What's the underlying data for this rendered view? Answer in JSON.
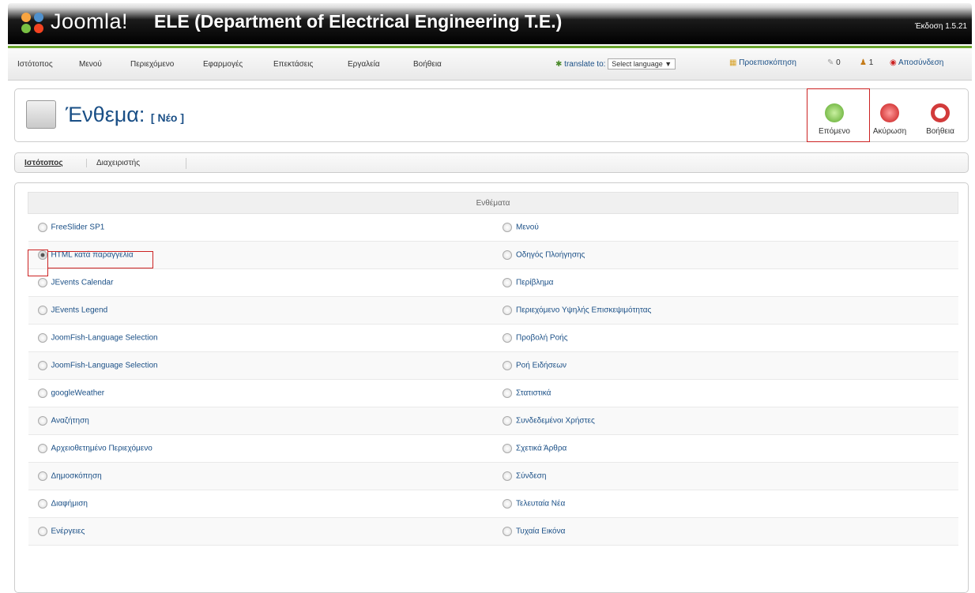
{
  "header": {
    "brand": "Joomla!",
    "site_name": "ELE (Department of Electrical Engineering T.E.)",
    "version": "Έκδοση 1.5.21"
  },
  "menubar": {
    "items": [
      "Ιστότοπος",
      "Μενού",
      "Περιεχόμενο",
      "Εφαρμογές",
      "Επεκτάσεις",
      "Εργαλεία",
      "Βοήθεια"
    ],
    "translate_label": "translate to:",
    "language_select": "Select language",
    "preview": "Προεπισκόπηση",
    "messages_count": "0",
    "users_count": "1",
    "logout": "Αποσύνδεση"
  },
  "toolbar": {
    "title": "Ένθεμα:",
    "subtitle": "[ Νέο ]",
    "next_label": "Επόμενο",
    "cancel_label": "Ακύρωση",
    "help_label": "Βοήθεια"
  },
  "tabs": [
    "Ιστότοπος",
    "Διαχειριστής"
  ],
  "modules": {
    "header": "Ενθέματα",
    "left": [
      "FreeSlider SP1",
      "HTML κατά παραγγελία",
      "JEvents Calendar",
      "JEvents Legend",
      "JoomFish-Language Selection",
      "JoomFish-Language Selection",
      "googleWeather",
      "Αναζήτηση",
      "Αρχειοθετημένο Περιεχόμενο",
      "Δημοσκόπηση",
      "Διαφήμιση",
      "Ενέργειες"
    ],
    "right": [
      "Μενού",
      "Οδηγός Πλοήγησης",
      "Περίβλημα",
      "Περιεχόμενο Υψηλής Επισκεψιμότητας",
      "Προβολή Ροής",
      "Ροή Ειδήσεων",
      "Στατιστικά",
      "Συνδεδεμένοι Χρήστες",
      "Σχετικά Άρθρα",
      "Σύνδεση",
      "Τελευταία Νέα",
      "Τυχαία Εικόνα"
    ],
    "selected": "HTML κατά παραγγελία"
  },
  "colors": {
    "accent_green": "#6aa52d",
    "link_blue": "#1a4f86",
    "highlight_red": "#cc2222"
  }
}
